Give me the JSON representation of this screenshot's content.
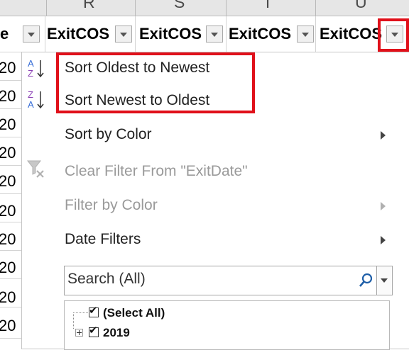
{
  "columns": {
    "letters": [
      "R",
      "S",
      "T",
      "U"
    ]
  },
  "header_row": {
    "cells": [
      "e",
      "ExitCOS",
      "ExitCOS",
      "ExitCOS",
      "ExitCOS"
    ]
  },
  "rows": {
    "visible_fragments": [
      "20",
      "20",
      "20",
      "20",
      "20",
      "20",
      "20",
      "20",
      "20",
      "20"
    ]
  },
  "menu": {
    "items": [
      {
        "label": "Sort Oldest to Newest",
        "state": "enabled",
        "highlighted": true
      },
      {
        "label": "Sort Newest to Oldest",
        "state": "enabled",
        "highlighted": true
      },
      {
        "label": "Sort by Color",
        "state": "enabled",
        "submenu": true
      },
      {
        "label": "Clear Filter From \"ExitDate\"",
        "state": "disabled"
      },
      {
        "label": "Filter by Color",
        "state": "disabled",
        "submenu": true
      },
      {
        "label": "Date Filters",
        "state": "enabled",
        "submenu": true
      }
    ],
    "search": {
      "placeholder": "Search (All)"
    },
    "tree": [
      {
        "label": "(Select All)",
        "checked": true
      },
      {
        "label": "2019",
        "checked": true,
        "expandable": true
      }
    ]
  },
  "colors": {
    "highlight_border": "#e0101a",
    "disabled_text": "#9a9a9a",
    "sort_icon_blue": "#3a6fd8",
    "sort_icon_purple": "#8a3fb4"
  },
  "icons": [
    "sort-ascending-icon",
    "sort-descending-icon",
    "clear-filter-icon",
    "search-icon",
    "submenu-arrow-icon",
    "filter-dropdown-icon"
  ]
}
